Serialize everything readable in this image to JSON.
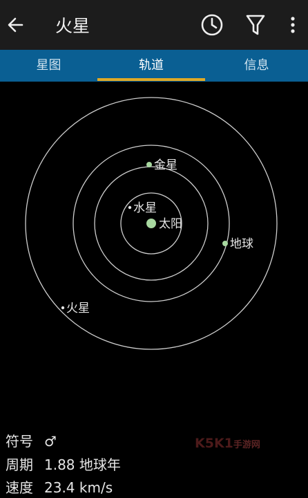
{
  "app_bar": {
    "title": "火星",
    "icons": [
      "arrow-left-icon",
      "clock-icon",
      "filter-icon",
      "more-vert-icon"
    ]
  },
  "tabs": [
    {
      "label": "星图",
      "active": false
    },
    {
      "label": "轨道",
      "active": true
    },
    {
      "label": "信息",
      "active": false
    }
  ],
  "orbit_view": {
    "bodies": {
      "sun": "太阳",
      "mercury": "水星",
      "venus": "金星",
      "earth": "地球",
      "mars": "火星"
    }
  },
  "details": {
    "symbol_label": "符号",
    "symbol_value": "♂",
    "period_label": "周期",
    "period_value": "1.88 地球年",
    "speed_label": "速度",
    "speed_value": "23.4 km/s"
  },
  "watermark": {
    "text": "K5K1",
    "sub": "手游网"
  },
  "colors": {
    "app_bar": "#1c1c1c",
    "tab_bar": "#0a5f93",
    "tab_indicator": "#e0a925",
    "planet_dot": "#a8d8a0",
    "orbit_line": "#cfcfcf"
  }
}
